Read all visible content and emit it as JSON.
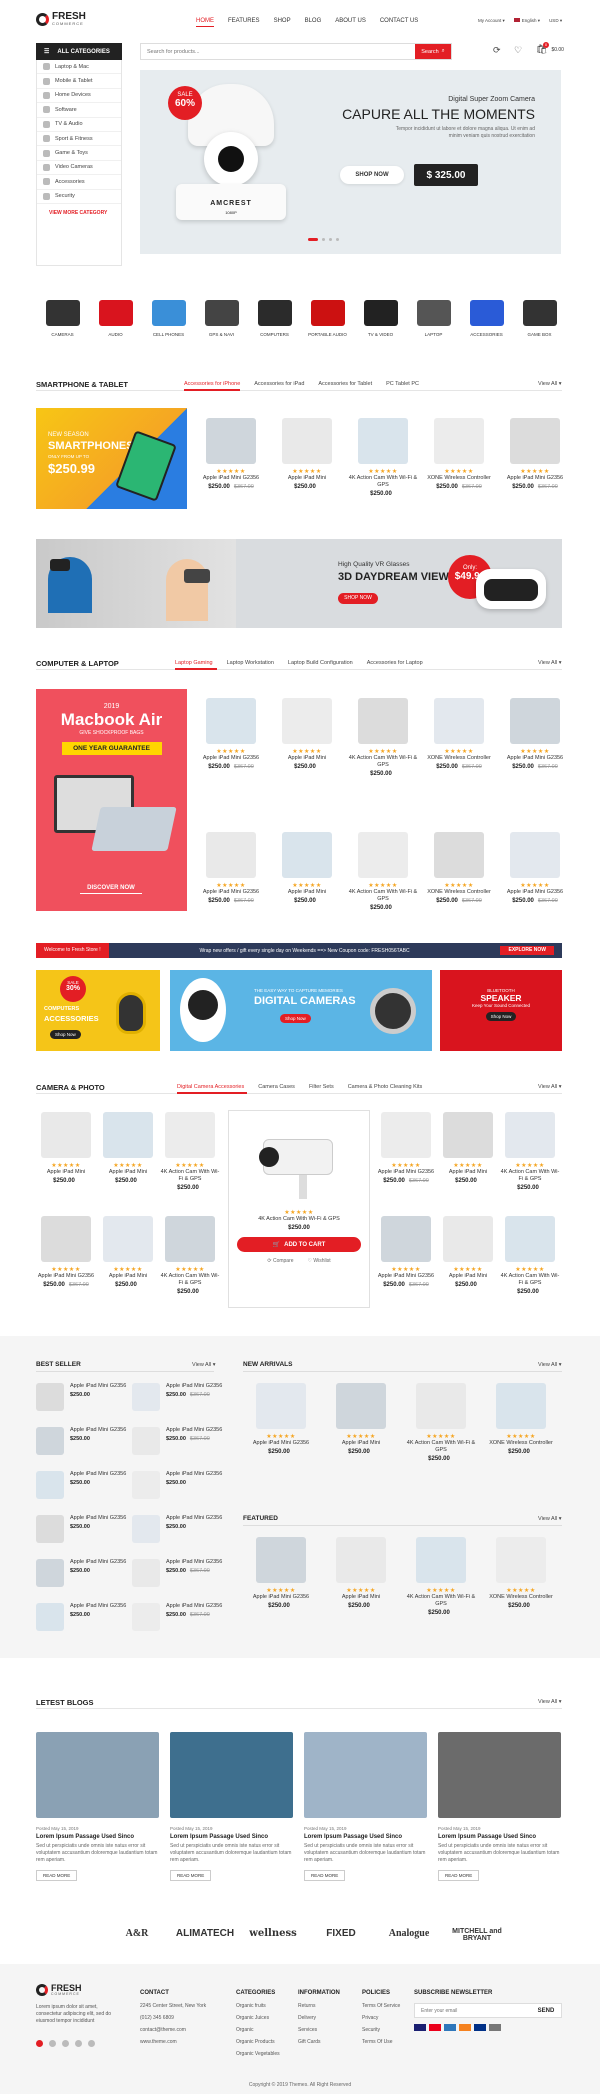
{
  "header": {
    "logo_main": "FRESH",
    "logo_sub": "COMMERCE",
    "nav": [
      "HOME",
      "FEATURES",
      "SHOP",
      "BLOG",
      "ABOUT US",
      "CONTACT US"
    ],
    "account": "My Account",
    "language": "English",
    "currency": "USD",
    "search_placeholder": "Search for products...",
    "search_btn": "Search",
    "cart_total": "$0.00",
    "cart_count": "0"
  },
  "sidebar": {
    "title": "ALL CATEGORIES",
    "items": [
      "Laptop & Mac",
      "Mobile & Tablet",
      "Home Devices",
      "Software",
      "TV & Audio",
      "Sport & Fitness",
      "Game & Toys",
      "Video Cameras",
      "Accessories",
      "Security"
    ],
    "more": "VIEW MORE CATEGORY"
  },
  "hero": {
    "sale": "SALE",
    "sale_pct": "60%",
    "subtitle": "Digital Super Zoom Camera",
    "title": "CAPURE ALL THE MOMENTS",
    "desc": "Tempor incididunt ut labore et dolore magna aliqua. Ut enim ad minim veniam quis nostrud exercitation",
    "shop": "SHOP NOW",
    "price": "$ 325.00",
    "brand": "AMCREST",
    "brand_sub": "1080P"
  },
  "categories": [
    "CAMERAS",
    "AUDIO",
    "CELL PHONES",
    "GPS & NAVI",
    "COMPUTERS",
    "PORTABLE AUDIO",
    "TV & VIDEO",
    "LAPTOP",
    "ACCESSORIES",
    "GAME BOX"
  ],
  "smartphone": {
    "title": "SMARTPHONE & TABLET",
    "tabs": [
      "Accessories for iPhone",
      "Accessories for iPad",
      "Accessories for Tablet",
      "PC Tablet PC"
    ],
    "view_all": "View All",
    "banner_l1": "NEW SEASON",
    "banner_l2": "SMARTPHONES",
    "banner_l3": "ONLY FROM UP TO",
    "banner_price": "$250.99",
    "products": [
      {
        "name": "Apple iPad Mini G2356",
        "price": "$250.00",
        "old": "$367.00"
      },
      {
        "name": "Apple iPad Mini",
        "price": "$250.00",
        "old": ""
      },
      {
        "name": "4K Action Cam With Wi-Fi & GPS",
        "price": "$250.00",
        "old": ""
      },
      {
        "name": "XONE Wireless Controller",
        "price": "$250.00",
        "old": "$367.00"
      },
      {
        "name": "Apple iPad Mini G2356",
        "price": "$250.00",
        "old": "$367.00"
      }
    ]
  },
  "vr": {
    "sub": "High Quality VR Glasses",
    "title": "3D DAYDREAM VIEW",
    "shop": "SHOP NOW",
    "only": "Only:",
    "price": "$49.99"
  },
  "computer": {
    "title": "COMPUTER & LAPTOP",
    "tabs": [
      "Laptop Gaming",
      "Laptop Workstation",
      "Laptop Build Configuration",
      "Accessories for Laptop"
    ],
    "view_all": "View All",
    "banner_year": "2019",
    "banner_title": "Macbook Air",
    "banner_sub": "GIVE SHOCKPROOF BAGS",
    "banner_guarantee": "ONE YEAR GUARANTEE",
    "banner_btn": "DISCOVER NOW",
    "products": [
      {
        "name": "Apple iPad Mini G2356",
        "price": "$250.00",
        "old": "$367.00"
      },
      {
        "name": "Apple iPad Mini",
        "price": "$250.00",
        "old": ""
      },
      {
        "name": "4K Action Cam With Wi-Fi & GPS",
        "price": "$250.00",
        "old": ""
      },
      {
        "name": "XONE Wireless Controller",
        "price": "$250.00",
        "old": "$367.00"
      },
      {
        "name": "Apple iPad Mini G2356",
        "price": "$250.00",
        "old": "$367.00"
      },
      {
        "name": "Apple iPad Mini G2356",
        "price": "$250.00",
        "old": "$367.00"
      },
      {
        "name": "Apple iPad Mini",
        "price": "$250.00",
        "old": ""
      },
      {
        "name": "4K Action Cam With Wi-Fi & GPS",
        "price": "$250.00",
        "old": ""
      },
      {
        "name": "XONE Wireless Controller",
        "price": "$250.00",
        "old": "$367.00"
      },
      {
        "name": "Apple iPad Mini G2356",
        "price": "$250.00",
        "old": "$367.00"
      }
    ]
  },
  "promo": {
    "welcome": "Welcome to Fresh Store !",
    "text": "Wrap new offers / gift every single day on Weekends ==> New Coupon code: FRESH056TABC",
    "explore": "EXPLORE NOW"
  },
  "banners3": {
    "b1_sale": "SALE",
    "b1_pct": "30%",
    "b1_l1": "COMPUTERS",
    "b1_l2": "ACCESSORIES",
    "b1_btn": "Shop Now",
    "b2_sub": "THE EASY WAY TO CAPTURE MEMORIES",
    "b2_title": "DIGITAL CAMERAS",
    "b2_btn": "Shop Now",
    "b3_sub": "BLUETOOTH",
    "b3_title": "SPEAKER",
    "b3_desc": "Keep Your Sound Connected",
    "b3_btn": "Shop Now"
  },
  "camera": {
    "title": "CAMERA & PHOTO",
    "tabs": [
      "Digital Camera Accessories",
      "Camera Cases",
      "Filter Sets",
      "Camera & Photo Cleaning Kits"
    ],
    "view_all": "View All",
    "left": [
      {
        "name": "Apple iPad Mini",
        "price": "$250.00",
        "old": ""
      },
      {
        "name": "Apple iPad Mini",
        "price": "$250.00",
        "old": ""
      },
      {
        "name": "4K Action Cam With Wi-Fi & GPS",
        "price": "$250.00",
        "old": ""
      },
      {
        "name": "Apple iPad Mini G2356",
        "price": "$250.00",
        "old": "$367.00"
      },
      {
        "name": "Apple iPad Mini",
        "price": "$250.00",
        "old": ""
      },
      {
        "name": "4K Action Cam With Wi-Fi & GPS",
        "price": "$250.00",
        "old": ""
      }
    ],
    "featured": {
      "name": "4K Action Cam With Wi-Fi & GPS",
      "price": "$250.00",
      "add": "ADD TO CART",
      "compare": "Compare",
      "wishlist": "Wishlist"
    },
    "right": [
      {
        "name": "Apple iPad Mini G2356",
        "price": "$250.00",
        "old": "$367.00"
      },
      {
        "name": "Apple iPad Mini",
        "price": "$250.00",
        "old": ""
      },
      {
        "name": "4K Action Cam With Wi-Fi & GPS",
        "price": "$250.00",
        "old": ""
      },
      {
        "name": "Apple iPad Mini G2356",
        "price": "$250.00",
        "old": "$367.00"
      },
      {
        "name": "Apple iPad Mini",
        "price": "$250.00",
        "old": ""
      },
      {
        "name": "4K Action Cam With Wi-Fi & GPS",
        "price": "$250.00",
        "old": ""
      }
    ]
  },
  "bestseller": {
    "title": "BEST SELLER",
    "view_all": "View All",
    "items": [
      {
        "name": "Apple iPad Mini G2356",
        "price": "$250.00",
        "old": ""
      },
      {
        "name": "Apple iPad Mini G2356",
        "price": "$250.00",
        "old": "$367.00"
      },
      {
        "name": "Apple iPad Mini G2356",
        "price": "$250.00",
        "old": ""
      },
      {
        "name": "Apple iPad Mini G2356",
        "price": "$250.00",
        "old": "$367.00"
      },
      {
        "name": "Apple iPad Mini G2356",
        "price": "$250.00",
        "old": ""
      },
      {
        "name": "Apple iPad Mini G2356",
        "price": "$250.00",
        "old": ""
      },
      {
        "name": "Apple iPad Mini G2356",
        "price": "$250.00",
        "old": ""
      },
      {
        "name": "Apple iPad Mini G2356",
        "price": "$250.00",
        "old": ""
      },
      {
        "name": "Apple iPad Mini G2356",
        "price": "$250.00",
        "old": ""
      },
      {
        "name": "Apple iPad Mini G2356",
        "price": "$250.00",
        "old": "$367.00"
      },
      {
        "name": "Apple iPad Mini G2356",
        "price": "$250.00",
        "old": ""
      },
      {
        "name": "Apple iPad Mini G2356",
        "price": "$250.00",
        "old": "$367.00"
      }
    ]
  },
  "new_arrivals": {
    "title": "NEW ARRIVALS",
    "view_all": "View All",
    "products": [
      {
        "name": "Apple iPad Mini G2356",
        "price": "$250.00",
        "old": ""
      },
      {
        "name": "Apple iPad Mini",
        "price": "$250.00",
        "old": ""
      },
      {
        "name": "4K Action Cam With Wi-Fi & GPS",
        "price": "$250.00",
        "old": ""
      },
      {
        "name": "XONE Wireless Controller",
        "price": "$250.00",
        "old": ""
      }
    ]
  },
  "featured": {
    "title": "FEATURED",
    "view_all": "View All",
    "products": [
      {
        "name": "Apple iPad Mini G2356",
        "price": "$250.00",
        "old": ""
      },
      {
        "name": "Apple iPad Mini",
        "price": "$250.00",
        "old": ""
      },
      {
        "name": "4K Action Cam With Wi-Fi & GPS",
        "price": "$250.00",
        "old": ""
      },
      {
        "name": "XONE Wireless Controller",
        "price": "$250.00",
        "old": ""
      }
    ]
  },
  "blogs": {
    "title": "LETEST BLOGS",
    "view_all": "View All",
    "posts": [
      {
        "date": "Posted May 15, 2019",
        "title": "Lorem Ipsum Passage Used Sinco",
        "text": "Sed ut perspiciatis unde omnis iste natus error sit voluptatem accusantium doloremque laudantium totam rem aperiam.",
        "btn": "READ MORE"
      },
      {
        "date": "Posted May 15, 2019",
        "title": "Lorem Ipsum Passage Used Sinco",
        "text": "Sed ut perspiciatis unde omnis iste natus error sit voluptatem accusantium doloremque laudantium totam rem aperiam.",
        "btn": "READ MORE"
      },
      {
        "date": "Posted May 15, 2019",
        "title": "Lorem Ipsum Passage Used Sinco",
        "text": "Sed ut perspiciatis unde omnis iste natus error sit voluptatem accusantium doloremque laudantium totam rem aperiam.",
        "btn": "READ MORE"
      },
      {
        "date": "Posted May 15, 2019",
        "title": "Lorem Ipsum Passage Used Sinco",
        "text": "Sed ut perspiciatis unde omnis iste natus error sit voluptatem accusantium doloremque laudantium totam rem aperiam.",
        "btn": "READ MORE"
      }
    ]
  },
  "brands": [
    "A&R",
    "ALIMATECH",
    "wellness",
    "FIXED",
    "Analogue",
    "MITCHELL and BRYANT"
  ],
  "footer": {
    "desc": "Lorem ipsum dolor sit amet, consectetur adipiscing elit, sed do eiusmod tempor incididunt",
    "contact_title": "CONTACT",
    "contact": [
      "2245 Center Street, New York",
      "(012) 345 6809",
      "contact@theme.com",
      "www.theme.com"
    ],
    "cat_title": "CATEGORIES",
    "cats": [
      "Organic fruits",
      "Organic Juices",
      "Organic",
      "Organic Products",
      "Organic Vegetables"
    ],
    "info_title": "INFORMATION",
    "info": [
      "Returns",
      "Delivery",
      "Services",
      "Gift Cards"
    ],
    "pol_title": "POLICIES",
    "pol": [
      "Terms Of Service",
      "Privacy",
      "Security",
      "Terms Of Use"
    ],
    "news_title": "SUBSCRIBE NEWSLETTER",
    "email_placeholder": "Enter your email",
    "send": "SEND",
    "copyright": "Copyright © 2019 Themes. All Right Reserved"
  }
}
